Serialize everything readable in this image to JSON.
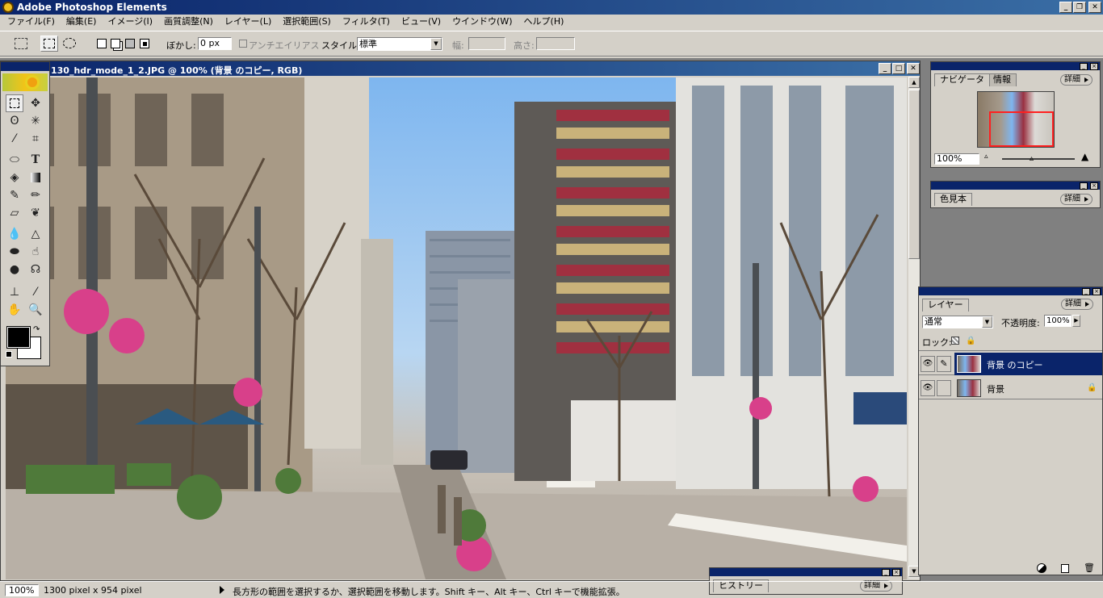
{
  "app": {
    "title": "Adobe Photoshop Elements"
  },
  "menu": [
    "ファイル(F)",
    "編集(E)",
    "イメージ(I)",
    "画質調整(N)",
    "レイヤー(L)",
    "選択範囲(S)",
    "フィルタ(T)",
    "ビュー(V)",
    "ウインドウ(W)",
    "ヘルプ(H)"
  ],
  "options": {
    "feather_label": "ぼかし:",
    "feather_value": "0 px",
    "antialias_label": "アンチエイリアス",
    "style_label": "スタイル:",
    "style_value": "標準",
    "width_label": "幅:",
    "height_label": "高さ:"
  },
  "document": {
    "title": "130_hdr_mode_1_2.JPG @ 100% (背景 のコピー, RGB)"
  },
  "navigator": {
    "tab1": "ナビゲータ",
    "tab2": "情報",
    "detail": "詳細",
    "zoom": "100%"
  },
  "swatches": {
    "tab": "色見本",
    "detail": "詳細"
  },
  "layers": {
    "tab": "レイヤー",
    "detail": "詳細",
    "blend_mode": "通常",
    "opacity_label": "不透明度:",
    "opacity_value": "100%",
    "lock_label": "ロック:",
    "items": [
      {
        "name": "背景 のコピー",
        "selected": true
      },
      {
        "name": "背景",
        "selected": false
      }
    ]
  },
  "history": {
    "tab": "ヒストリー",
    "detail": "詳細"
  },
  "status": {
    "zoom": "100%",
    "size": "1300 pixel x 954 pixel",
    "hint": "長方形の範囲を選択するか、選択範囲を移動します。Shift キー、Alt キー、Ctrl キーで機能拡張。"
  }
}
